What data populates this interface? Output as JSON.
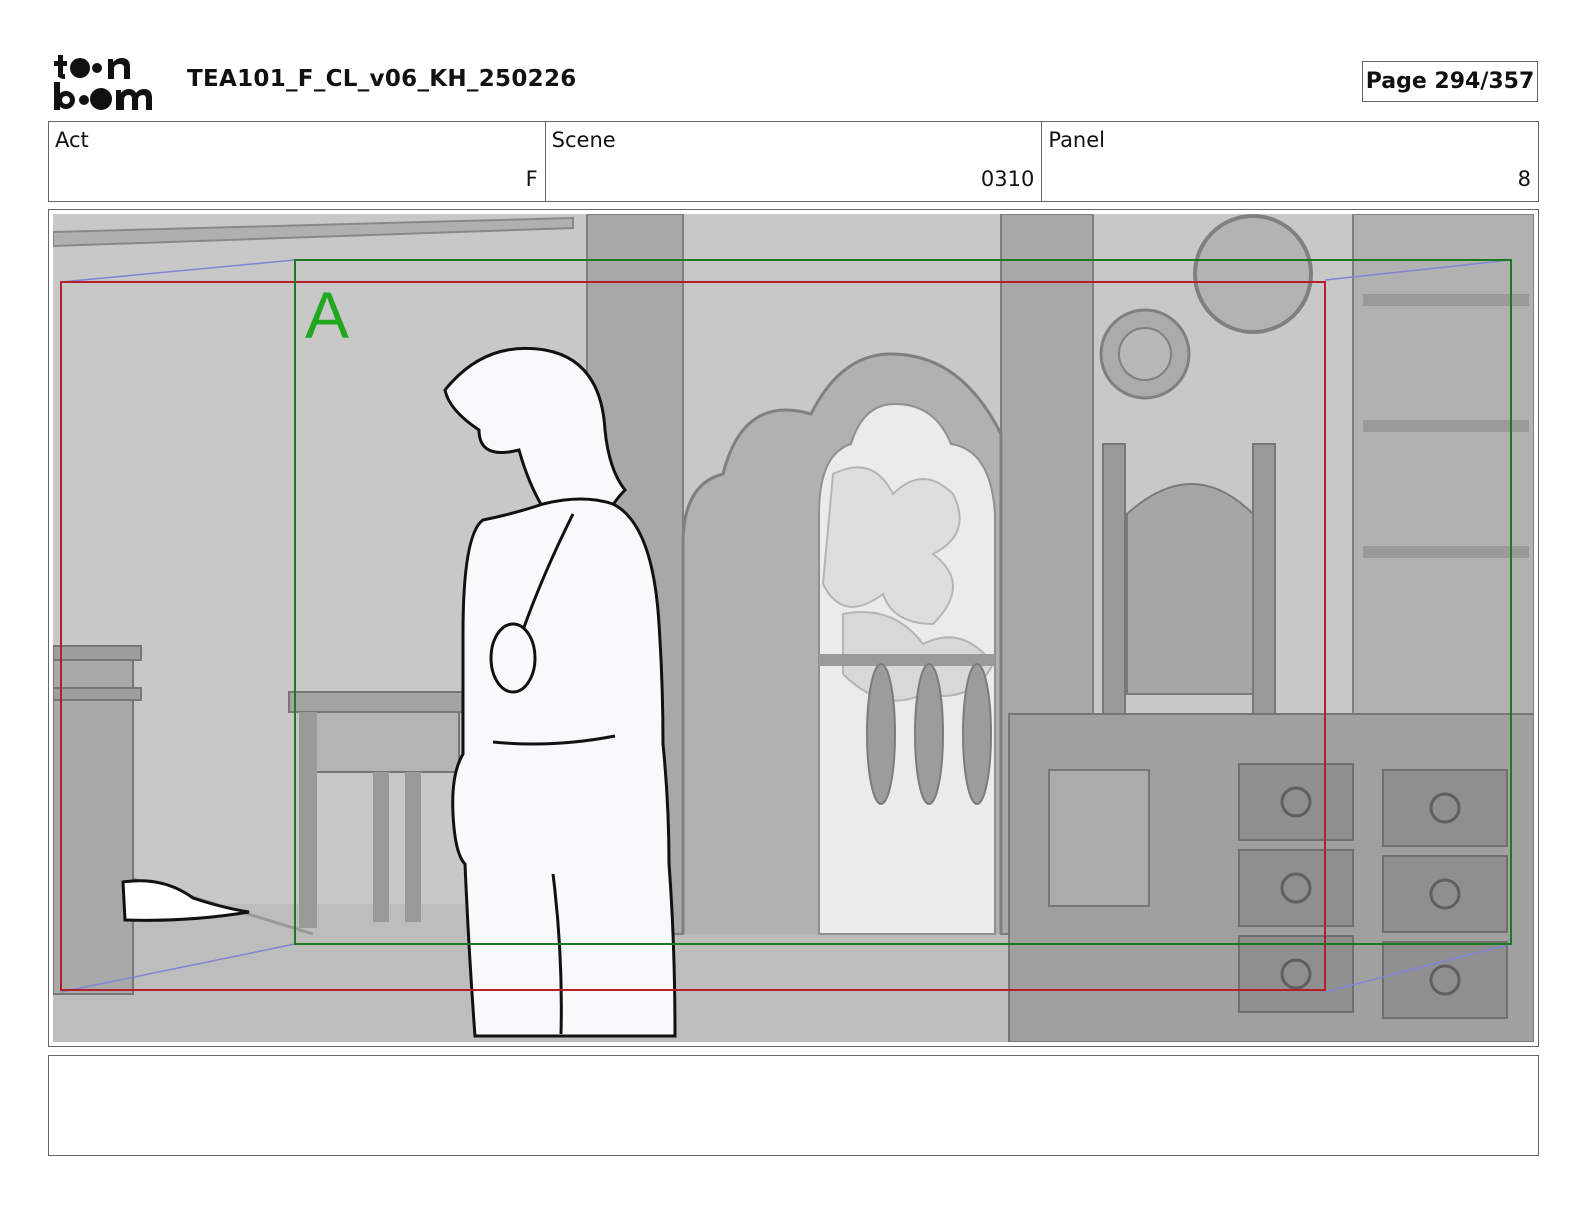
{
  "header": {
    "doc_title": "TEA101_F_CL_v06_KH_250226",
    "page_label": "Page 294/357"
  },
  "info": {
    "act": {
      "label": "Act",
      "value": "F"
    },
    "scene": {
      "label": "Scene",
      "value": "0310"
    },
    "panel": {
      "label": "Panel",
      "value": "8"
    }
  },
  "panel": {
    "camera_label": "A",
    "colors": {
      "camera_frame": "#1f7a1f",
      "safe_frame": "#b3202a",
      "move_guide": "#7d86d6",
      "camera_label": "#21a821"
    }
  },
  "notes": {
    "text": ""
  }
}
